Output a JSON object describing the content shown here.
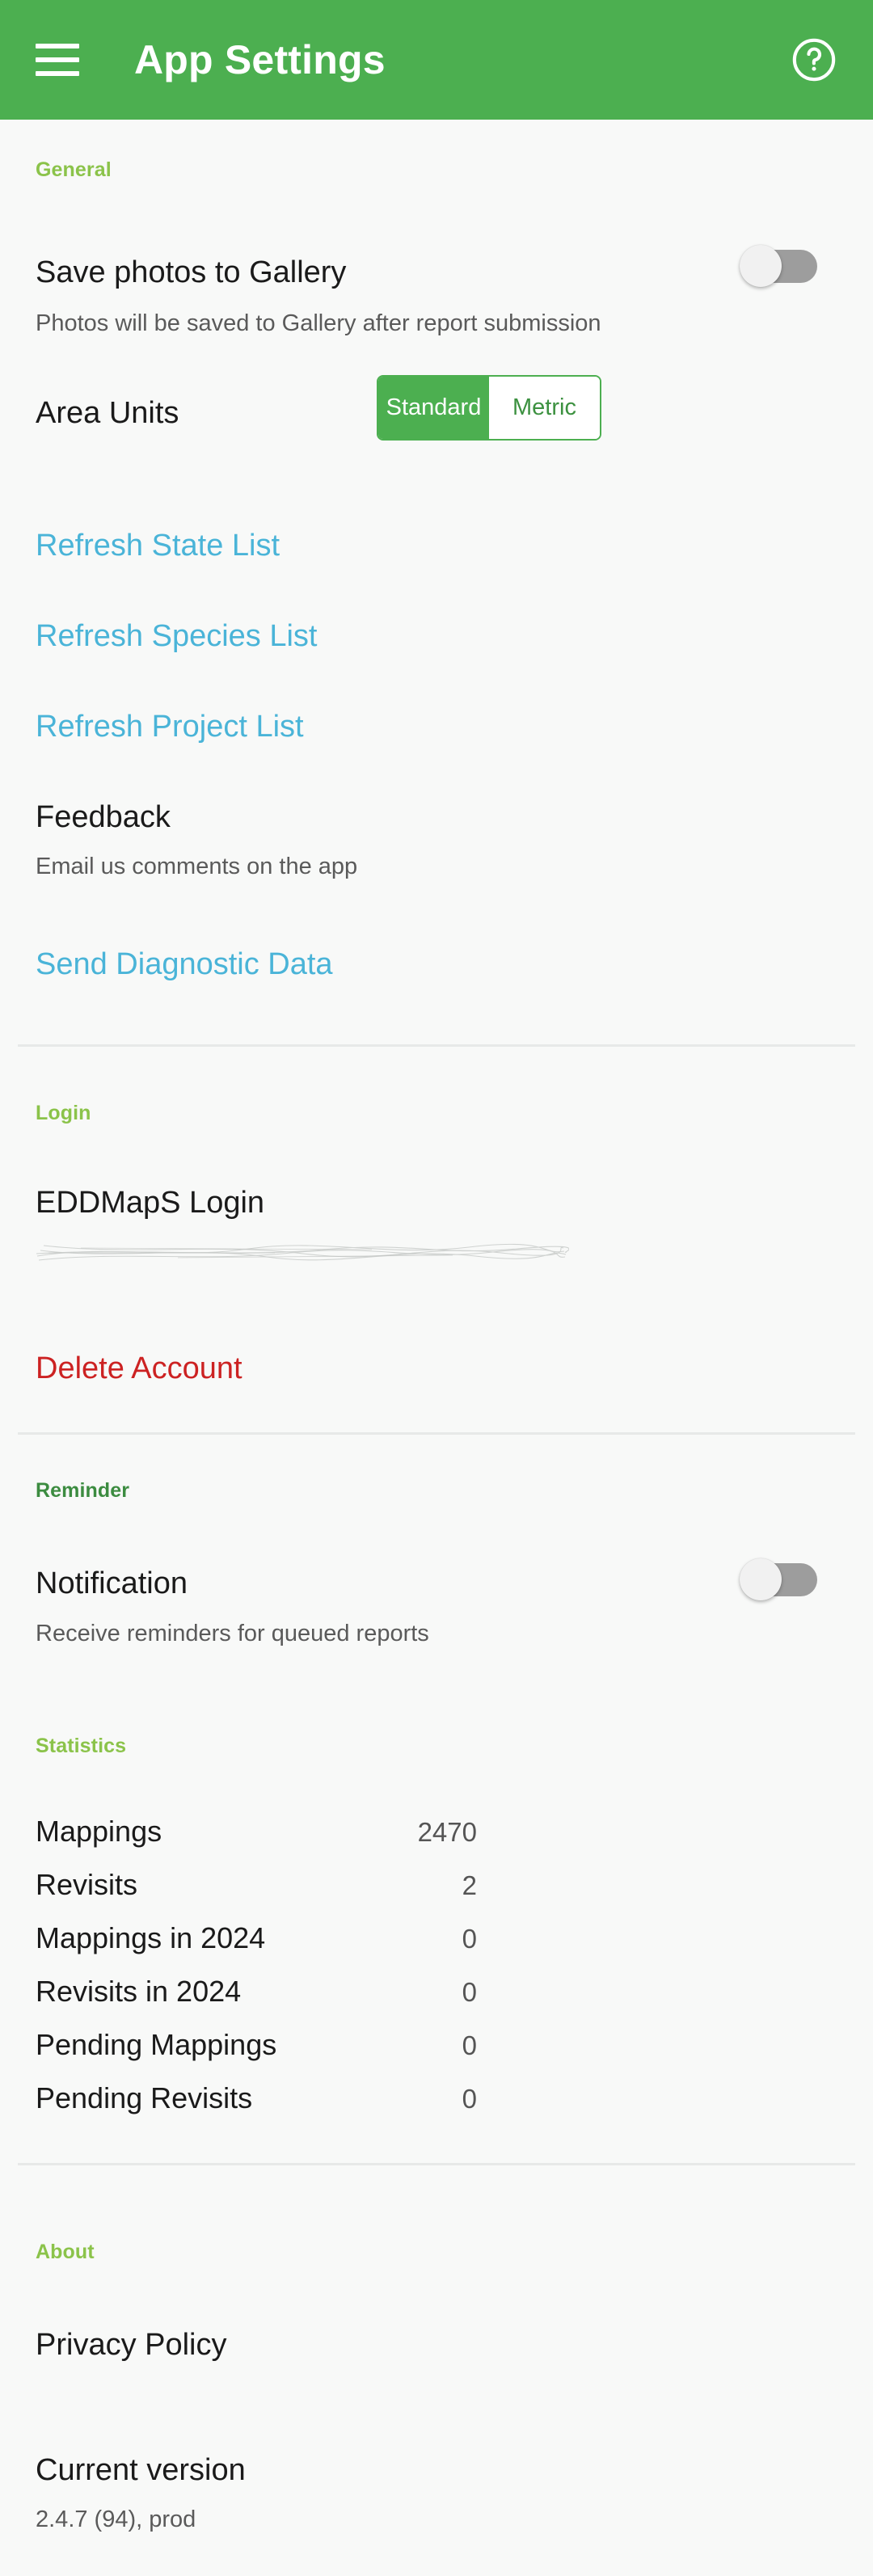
{
  "appbar": {
    "menu_icon": "hamburger-menu-icon",
    "title": "App Settings",
    "help_icon": "help-circle-icon",
    "background_color": "#4caf50"
  },
  "sections": {
    "general": {
      "header": "General",
      "save_photos": {
        "label": "Save photos to Gallery",
        "description": "Photos will be saved to Gallery after report submission",
        "toggle_state": "off"
      },
      "area_units": {
        "label": "Area Units",
        "options": [
          "Standard",
          "Metric"
        ],
        "selected": "Standard"
      },
      "links": [
        "Refresh State List",
        "Refresh Species List",
        "Refresh Project List"
      ],
      "feedback": {
        "label": "Feedback",
        "description": "Email us comments on the app"
      },
      "diagnostic_link": "Send Diagnostic Data"
    },
    "login": {
      "header": "Login",
      "label": "EDDMapS Login",
      "account_value": "",
      "account_redacted": true,
      "delete_account": "Delete Account"
    },
    "reminder": {
      "header": "Reminder",
      "notification": {
        "label": "Notification",
        "description": "Receive reminders for queued reports",
        "toggle_state": "off"
      }
    },
    "statistics": {
      "header": "Statistics",
      "rows": [
        {
          "label": "Mappings",
          "value": "2470"
        },
        {
          "label": "Revisits",
          "value": "2"
        },
        {
          "label": "Mappings in 2024",
          "value": "0"
        },
        {
          "label": "Revisits in 2024",
          "value": "0"
        },
        {
          "label": "Pending Mappings",
          "value": "0"
        },
        {
          "label": "Pending Revisits",
          "value": "0"
        }
      ]
    },
    "about": {
      "header": "About",
      "privacy_policy": "Privacy Policy",
      "current_version_label": "Current version",
      "current_version_value": "2.4.7 (94), prod"
    }
  },
  "colors": {
    "accent_green": "#4caf50",
    "section_header_light": "#8bc34a",
    "section_header_dark": "#3c8c40",
    "link_blue": "#4ab4d8",
    "danger_red": "#cc2222",
    "page_background": "#f8f9f8"
  }
}
